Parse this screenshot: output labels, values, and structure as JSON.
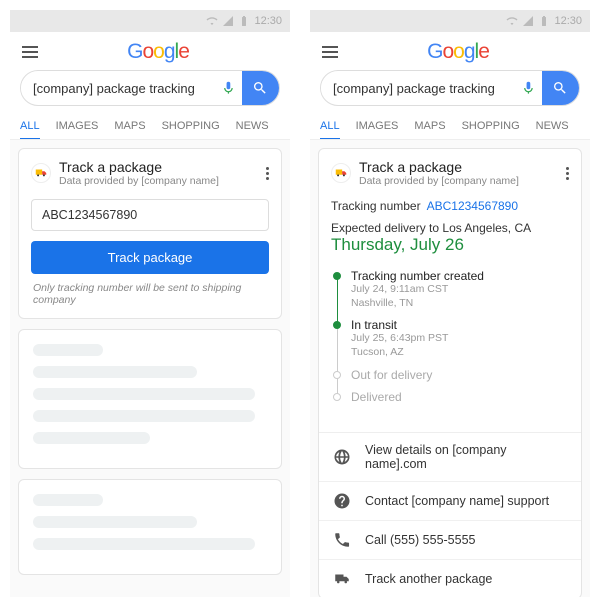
{
  "status": {
    "time": "12:30"
  },
  "logo": "Google",
  "search": {
    "query": "[company] package tracking"
  },
  "tabs": [
    "ALL",
    "IMAGES",
    "MAPS",
    "SHOPPING",
    "NEWS"
  ],
  "card": {
    "title": "Track a package",
    "subtitle": "Data provided by [company name]",
    "input_value": "ABC1234567890",
    "button": "Track package",
    "disclaimer": "Only tracking number will be sent to shipping company"
  },
  "result": {
    "tracking_label": "Tracking number",
    "tracking_number": "ABC1234567890",
    "expected": "Expected delivery to Los Angeles, CA",
    "date": "Thursday, July 26",
    "timeline": [
      {
        "label": "Tracking number created",
        "sub1": "July 24, 9:11am CST",
        "sub2": "Nashville, TN"
      },
      {
        "label": "In transit",
        "sub1": "July 25, 6:43pm PST",
        "sub2": "Tucson, AZ"
      },
      {
        "label": "Out for delivery"
      },
      {
        "label": "Delivered"
      }
    ],
    "actions": [
      "View details on [company name].com",
      "Contact [company name] support",
      "Call (555) 555-5555",
      "Track another package"
    ]
  }
}
